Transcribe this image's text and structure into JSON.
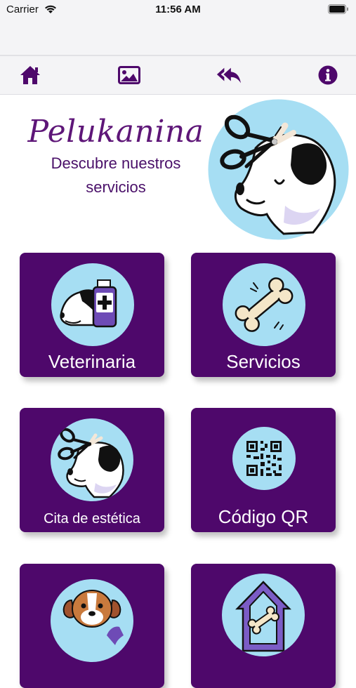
{
  "status": {
    "carrier": "Carrier",
    "time": "11:56 AM"
  },
  "toolbar": {
    "home_icon": "home-icon",
    "gallery_icon": "image-icon",
    "back_icon": "reply-all-icon",
    "info_icon": "info-icon"
  },
  "brand": {
    "title": "Pelukanina",
    "subtitle_line1": "Descubre nuestros",
    "subtitle_line2": "servicios"
  },
  "colors": {
    "accent": "#4e086b",
    "icon_bg": "#a6def3",
    "title": "#5e1678"
  },
  "menu": [
    {
      "label": "Veterinaria",
      "icon": "dog-medicine-icon"
    },
    {
      "label": "Servicios",
      "icon": "bone-icon"
    },
    {
      "label": "Cita de estética",
      "icon": "dog-scissors-icon"
    },
    {
      "label": "Código QR",
      "icon": "qr-code-icon"
    },
    {
      "label": "",
      "icon": "dog-phone-icon"
    },
    {
      "label": "",
      "icon": "dog-house-icon"
    }
  ]
}
